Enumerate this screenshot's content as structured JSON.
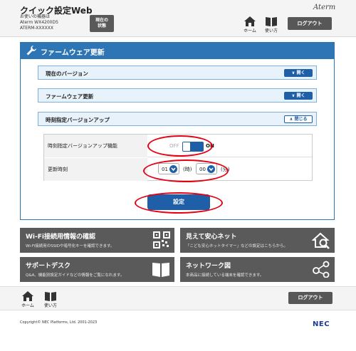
{
  "header": {
    "title": "クイック設定Web",
    "model_lines": [
      "お使いの機器は",
      "Aterm  WX4200D5",
      "ATERM-XXXXXX"
    ],
    "status_button": [
      "現在の",
      "状態"
    ],
    "brand": "Aterm",
    "home_label": "ホーム",
    "help_label": "使い方",
    "logout_label": "ログアウト"
  },
  "panel": {
    "title": "ファームウェア更新",
    "sections": [
      {
        "label": "現在のバージョン",
        "button": "開く"
      },
      {
        "label": "ファームウェア更新",
        "button": "開く"
      },
      {
        "label": "時刻指定バージョンアップ",
        "button": "閉じる"
      }
    ],
    "settings": {
      "auto_update_label": "時刻指定バージョンアップ機能",
      "toggle_off": "OFF",
      "toggle_on": "ON",
      "update_time_label": "更新時刻",
      "hour_value": "01",
      "hour_unit": "(時)",
      "minute_value": "00",
      "minute_unit": "(分)"
    },
    "submit_label": "設定"
  },
  "tiles": [
    {
      "title": "Wi-Fi接続用情報の確認",
      "desc": "Wi-Fi接続用のSSIDや暗号化キーを確認できます。",
      "icon": "qr-code-icon"
    },
    {
      "title": "見えて安心ネット",
      "desc": "「こども安心ネットタイマー」などの設定はこちらから。",
      "icon": "house-search-icon"
    },
    {
      "title": "サポートデスク",
      "desc": "Q&A、機能別設定ガイドなどの情報をご覧になれます。",
      "icon": "book-icon"
    },
    {
      "title": "ネットワーク図",
      "desc": "本商品に接続している端末を確認できます。",
      "icon": "network-icon"
    }
  ],
  "footer": {
    "home_label": "ホーム",
    "help_label": "使い方",
    "logout_label": "ログアウト",
    "copyright": "Copyright© NEC Platforms, Ltd. 2001-2023",
    "logo": "NEC"
  },
  "colors": {
    "accent": "#2e75b6",
    "button_dark": "#575757",
    "highlight": "#e60012",
    "tile": "#5a5a5a"
  }
}
